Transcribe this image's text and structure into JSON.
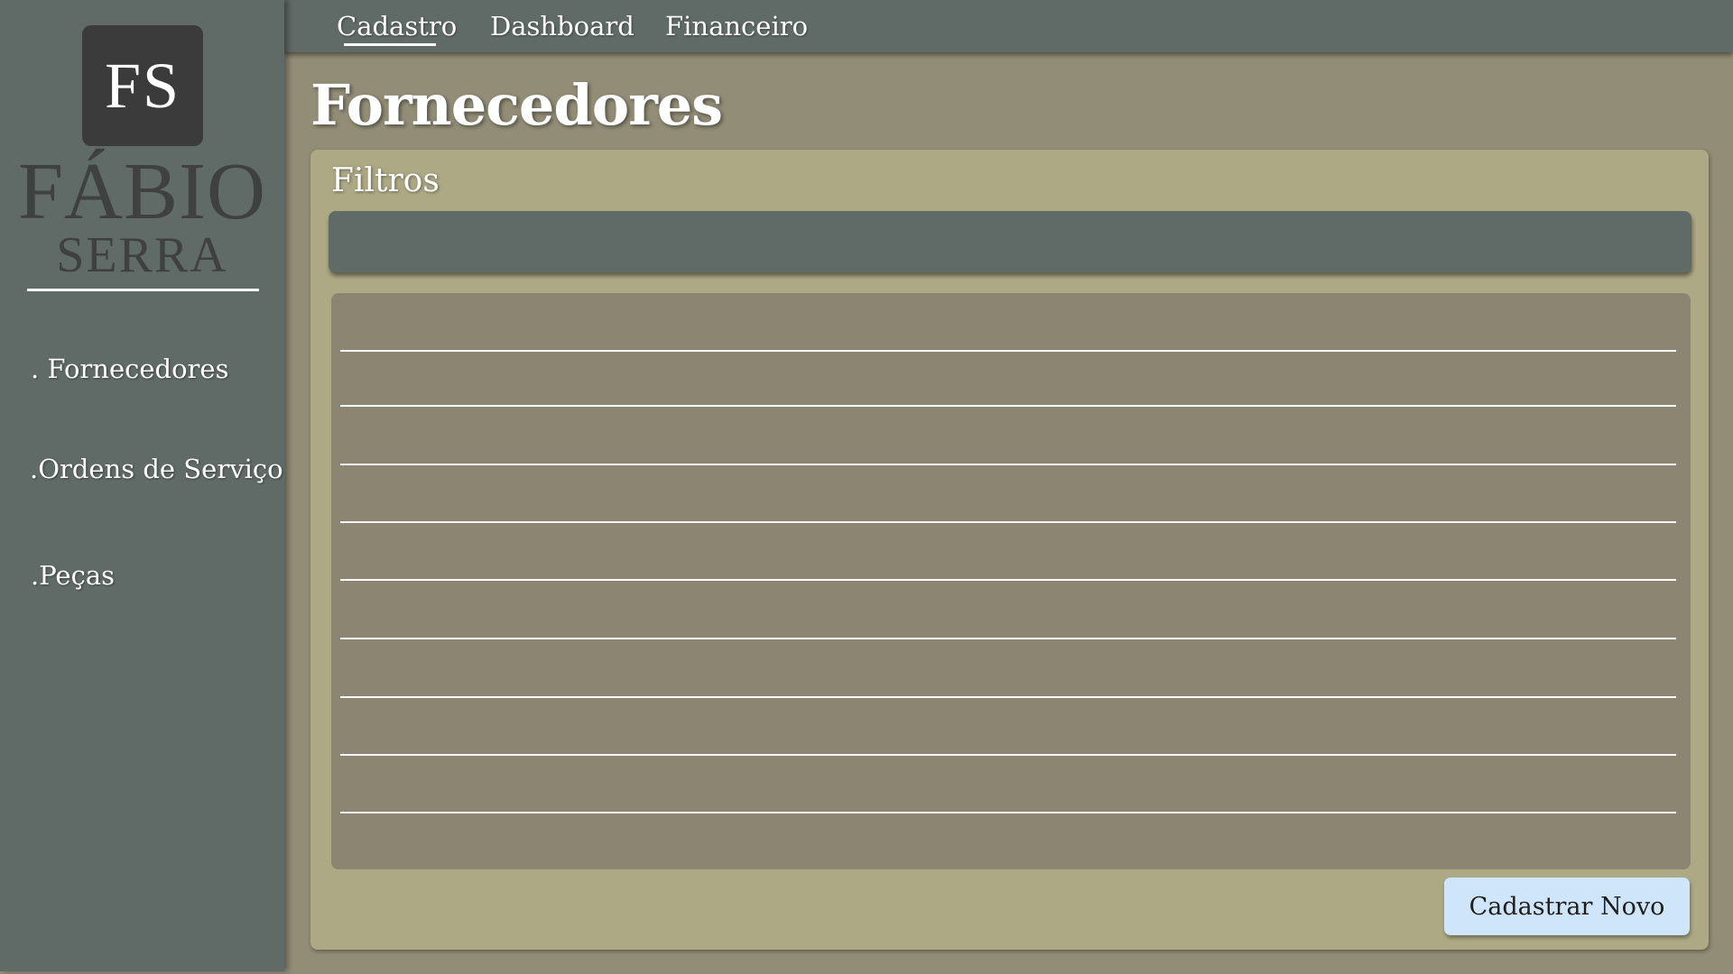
{
  "brand": {
    "logo_initials": "FS",
    "name": "FÁBIO",
    "subname": "SERRA"
  },
  "sidebar": {
    "items": [
      {
        "label": ". Fornecedores"
      },
      {
        "label": ".Ordens de Serviço"
      },
      {
        "label": ".Peças"
      }
    ]
  },
  "topnav": {
    "tabs": [
      {
        "label": "Cadastro",
        "active": true
      },
      {
        "label": "Dashboard",
        "active": false
      },
      {
        "label": "Financeiro",
        "active": false
      }
    ]
  },
  "main": {
    "title": "Fornecedores",
    "filters_label": "Filtros",
    "table_rows": 9,
    "new_button_label": "Cadastrar Novo"
  },
  "colors": {
    "sidebar_bg": "#606a66",
    "page_bg": "#928d77",
    "card_bg": "#ada985",
    "table_bg": "#8b8571",
    "button_bg": "#cfe5fa"
  }
}
